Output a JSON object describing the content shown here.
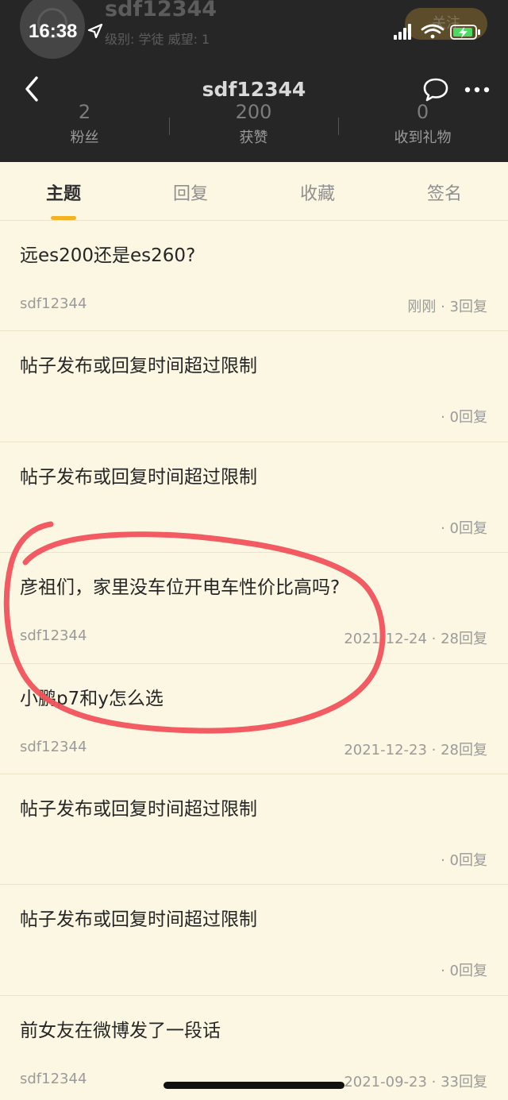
{
  "status_bar": {
    "time": "16:38"
  },
  "profile": {
    "name": "sdf12344",
    "level_text": "级别: 学徒 威望: 1",
    "follow_label": "关注"
  },
  "nav": {
    "title": "sdf12344"
  },
  "stats": [
    {
      "value": "2",
      "label": "粉丝"
    },
    {
      "value": "200",
      "label": "获赞"
    },
    {
      "value": "0",
      "label": "收到礼物"
    }
  ],
  "tabs": [
    {
      "label": "主题",
      "active": true
    },
    {
      "label": "回复",
      "active": false
    },
    {
      "label": "收藏",
      "active": false
    },
    {
      "label": "签名",
      "active": false
    }
  ],
  "posts": [
    {
      "title": "远es200还是es260?",
      "author": "sdf12344",
      "meta": "刚刚 · 3回复"
    },
    {
      "title": "帖子发布或回复时间超过限制",
      "author": "",
      "meta": "· 0回复"
    },
    {
      "title": "帖子发布或回复时间超过限制",
      "author": "",
      "meta": "· 0回复"
    },
    {
      "title": "彦祖们，家里没车位开电车性价比高吗?",
      "author": "sdf12344",
      "meta": "2021-12-24 · 28回复"
    },
    {
      "title": "小鹏p7和y怎么选",
      "author": "sdf12344",
      "meta": "2021-12-23 · 28回复"
    },
    {
      "title": "帖子发布或回复时间超过限制",
      "author": "",
      "meta": "· 0回复"
    },
    {
      "title": "帖子发布或回复时间超过限制",
      "author": "",
      "meta": "· 0回复"
    },
    {
      "title": "前女友在微博发了一段话",
      "author": "sdf12344",
      "meta": "2021-09-23 · 33回复"
    }
  ],
  "colors": {
    "header_bg": "#262626",
    "page_bg": "#fcf7e3",
    "accent": "#f4b323",
    "annotation": "#f0525a"
  },
  "icons": [
    "location-arrow-icon",
    "signal-icon",
    "wifi-icon",
    "battery-charging-icon",
    "back-chevron-icon",
    "chat-bubble-icon",
    "more-dots-icon"
  ]
}
